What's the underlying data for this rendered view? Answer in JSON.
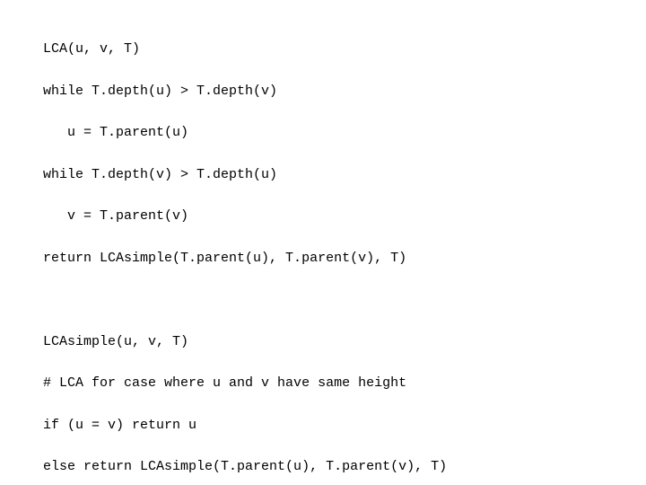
{
  "code": {
    "lines": [
      "LCA(u, v, T)",
      "while T.depth(u) > T.depth(v)",
      "   u = T.parent(u)",
      "while T.depth(v) > T.depth(u)",
      "   v = T.parent(v)",
      "return LCAsimple(T.parent(u), T.parent(v), T)",
      "",
      "LCAsimple(u, v, T)",
      "# LCA for case where u and v have same height",
      "if (u = v) return u",
      "else return LCAsimple(T.parent(u), T.parent(v), T)"
    ]
  }
}
